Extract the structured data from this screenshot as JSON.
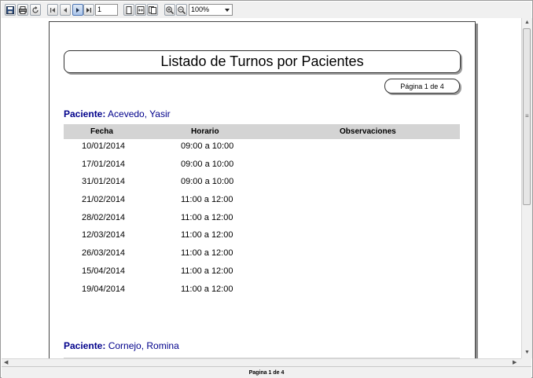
{
  "toolbar": {
    "page_value": "1",
    "zoom_value": "100%",
    "icons": [
      "save-icon",
      "print-icon",
      "refresh-icon",
      "first-page-icon",
      "prev-page-icon",
      "next-page-icon",
      "last-page-icon",
      "single-page-icon",
      "fit-width-icon",
      "multi-page-icon",
      "zoom-in-icon",
      "zoom-out-icon"
    ]
  },
  "report": {
    "title": "Listado de Turnos por Pacientes",
    "page_pill": "Página 1 de 4",
    "patient_label": "Paciente:",
    "columns": [
      "Fecha",
      "Horario",
      "Observaciones"
    ],
    "patients": [
      {
        "name": "Acevedo, Yasir",
        "rows": [
          {
            "fecha": "10/01/2014",
            "horario": "09:00 a 10:00"
          },
          {
            "fecha": "17/01/2014",
            "horario": "09:00 a 10:00"
          },
          {
            "fecha": "31/01/2014",
            "horario": "09:00 a 10:00"
          },
          {
            "fecha": "21/02/2014",
            "horario": "11:00 a 12:00"
          },
          {
            "fecha": "28/02/2014",
            "horario": "11:00 a 12:00"
          },
          {
            "fecha": "12/03/2014",
            "horario": "11:00 a 12:00"
          },
          {
            "fecha": "26/03/2014",
            "horario": "11:00 a 12:00"
          },
          {
            "fecha": "15/04/2014",
            "horario": "11:00 a 12:00"
          },
          {
            "fecha": "19/04/2014",
            "horario": "11:00 a 12:00"
          }
        ]
      },
      {
        "name": "Cornejo, Romina",
        "rows": []
      }
    ]
  },
  "statusbar": {
    "text": "Pagina 1 de 4"
  }
}
